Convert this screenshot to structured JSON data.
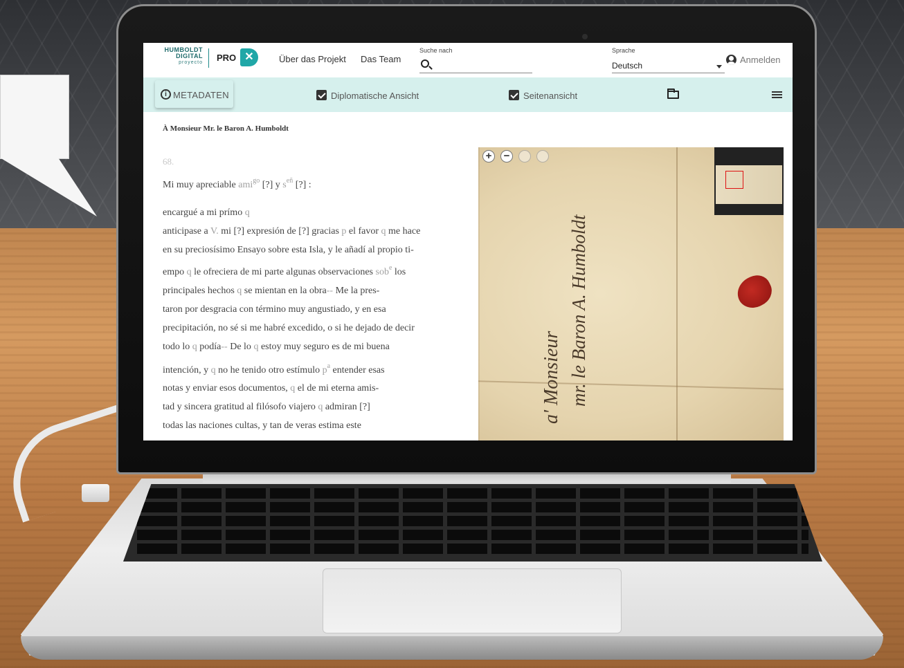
{
  "header": {
    "logo": {
      "line1": "HUMBOLDT",
      "line2": "DIGITAL",
      "line3": "proyecto"
    },
    "product": "PRO",
    "nav": [
      {
        "label": "Über das Projekt"
      },
      {
        "label": "Das Team"
      }
    ],
    "search": {
      "label": "Suche nach",
      "value": "",
      "icon": "search-icon"
    },
    "language": {
      "label": "Sprache",
      "selected": "Deutsch"
    },
    "login": {
      "label": "Anmelden",
      "icon": "user-circle-icon"
    }
  },
  "toolbar": {
    "metadata_label": "METADATEN",
    "diplomatic_label": "Diplomatische Ansicht",
    "diplomatic_checked": true,
    "page_label": "Seitenansicht",
    "page_checked": true,
    "folder_icon": "folder-icon",
    "menu_icon": "menu-icon"
  },
  "document": {
    "title": "À Monsieur Mr. le Baron A. Humboldt",
    "line_number": "68.",
    "salutation": {
      "a": "Mi muy apreciable ",
      "b": "ami",
      "c": "go",
      "d": " [?] y ",
      "e": "s",
      "f": "eñ",
      "g": " [?] :"
    },
    "lines": {
      "l1": {
        "a": "encargué a mi prímo ",
        "b": "q"
      },
      "l2": {
        "a": "anticipase a ",
        "b": "V.",
        "c": " mi [?] expresión de [?] gracias ",
        "d": "p",
        "e": " el favor ",
        "f": "q",
        "g": " me hace"
      },
      "l3": {
        "a": "en su preciosísimo Ensayo sobre esta Isla, y le añadí al propio ti-"
      },
      "l4": {
        "a": "empo ",
        "b": "q",
        "c": " le ofreciera de mi parte algunas observaciones ",
        "d": "sob",
        "e": "e",
        "f": " los"
      },
      "l5": {
        "a": "principales hechos ",
        "b": "q",
        "c": " se mientan en la obra",
        "d": "--",
        "e": " Me la pres-"
      },
      "l6": {
        "a": "taron por desgracia con término muy angustiado, y en esa"
      },
      "l7": {
        "a": "precipitación, no sé si me habré excedido, o si he dejado de decir"
      },
      "l8": {
        "a": "todo lo ",
        "b": "q",
        "c": " podía",
        "d": "--",
        "e": " De lo ",
        "f": "q",
        "g": " estoy muy seguro es de mi buena"
      },
      "l9": {
        "a": "intención, y ",
        "b": "q",
        "c": " no he tenido otro estímulo ",
        "d": "p",
        "e": "a",
        "f": " entender esas"
      },
      "l10": {
        "a": "notas y enviar esos documentos, ",
        "b": "q",
        "c": " el de mi eterna amis-"
      },
      "l11": {
        "a": "tad y sincera gratitud al filósofo viajero ",
        "b": "q",
        "c": " admiran [?]"
      },
      "l12": {
        "a": "todas las naciones cultas, y tan de veras estima este"
      }
    }
  },
  "viewer": {
    "handwriting": {
      "line1": "a' Monsieur",
      "line2": "mr. le Baron A. Humboldt"
    },
    "zoom_in": "+",
    "zoom_out": "−"
  }
}
